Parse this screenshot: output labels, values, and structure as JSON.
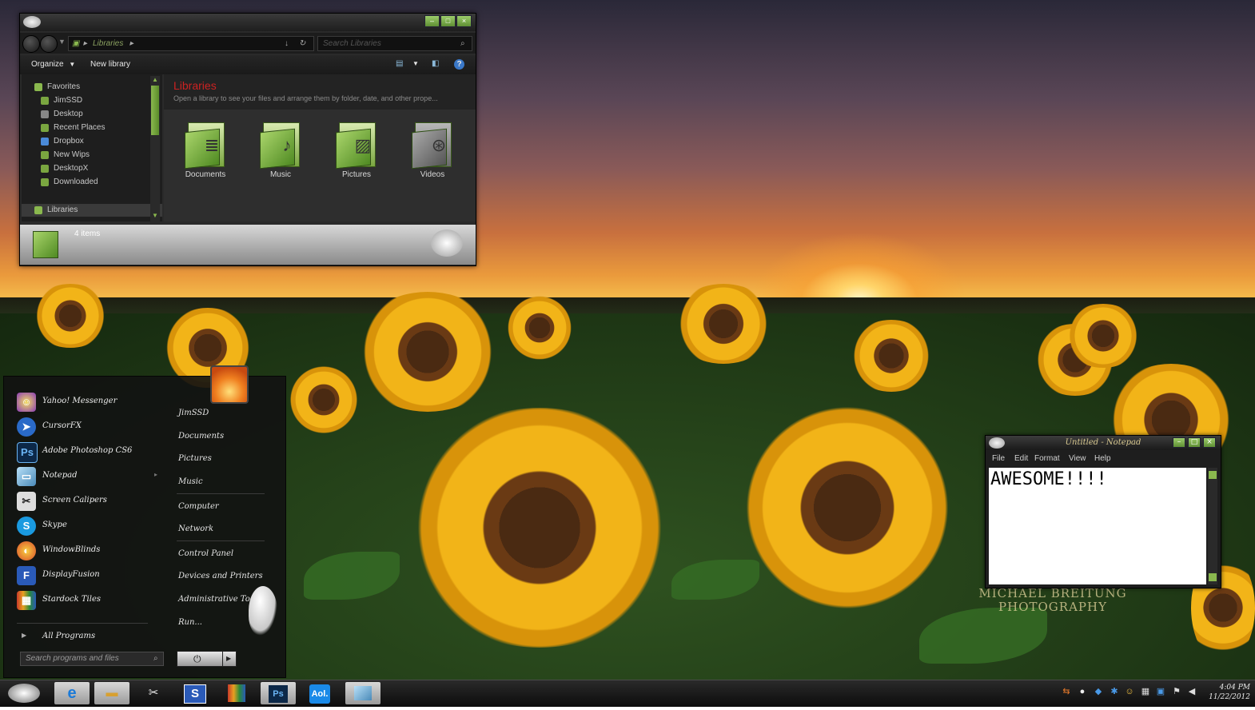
{
  "explorer": {
    "address_path": "Libraries",
    "search_placeholder": "Search Libraries",
    "toolbar": {
      "organize": "Organize",
      "new_library": "New library"
    },
    "sidebar": {
      "favorites_header": "Favorites",
      "items": [
        "JimSSD",
        "Desktop",
        "Recent Places",
        "Dropbox",
        "New Wips",
        "DesktopX",
        "Downloaded"
      ],
      "libraries_header": "Libraries"
    },
    "main": {
      "title": "Libraries",
      "description": "Open a library to see your files and arrange them by folder, date, and other prope...",
      "libraries": [
        "Documents",
        "Music",
        "Pictures",
        "Videos"
      ]
    },
    "status": "4 items"
  },
  "start_menu": {
    "programs": [
      "Yahoo! Messenger",
      "CursorFX",
      "Adobe Photoshop CS6",
      "Notepad",
      "Screen Calipers",
      "Skype",
      "WindowBlinds",
      "DisplayFusion",
      "Stardock Tiles"
    ],
    "all_programs": "All Programs",
    "places": [
      "JimSSD",
      "Documents",
      "Pictures",
      "Music",
      "Computer",
      "Network",
      "Control Panel",
      "Devices and Printers",
      "Administrative Tools",
      "Run..."
    ],
    "search_placeholder": "Search programs and files"
  },
  "notepad": {
    "title": "Untitled - Notepad",
    "menu": [
      "File",
      "Edit",
      "Format",
      "View",
      "Help"
    ],
    "content": "AWESOME!!!!"
  },
  "desktop": {
    "watermark_line1": "MICHAEL BREITUNG",
    "watermark_line2": "PHOTOGRAPHY"
  },
  "taskbar": {
    "apps": [
      "internet-explorer",
      "file-explorer",
      "cursorfx",
      "stardock",
      "stardock-tiles",
      "photoshop",
      "aol",
      "notepad"
    ],
    "clock_time": "4:04 PM",
    "clock_date": "11/22/2012"
  },
  "colors": {
    "accent_green": "#8ab84e",
    "library_title_red": "#cc2222"
  }
}
